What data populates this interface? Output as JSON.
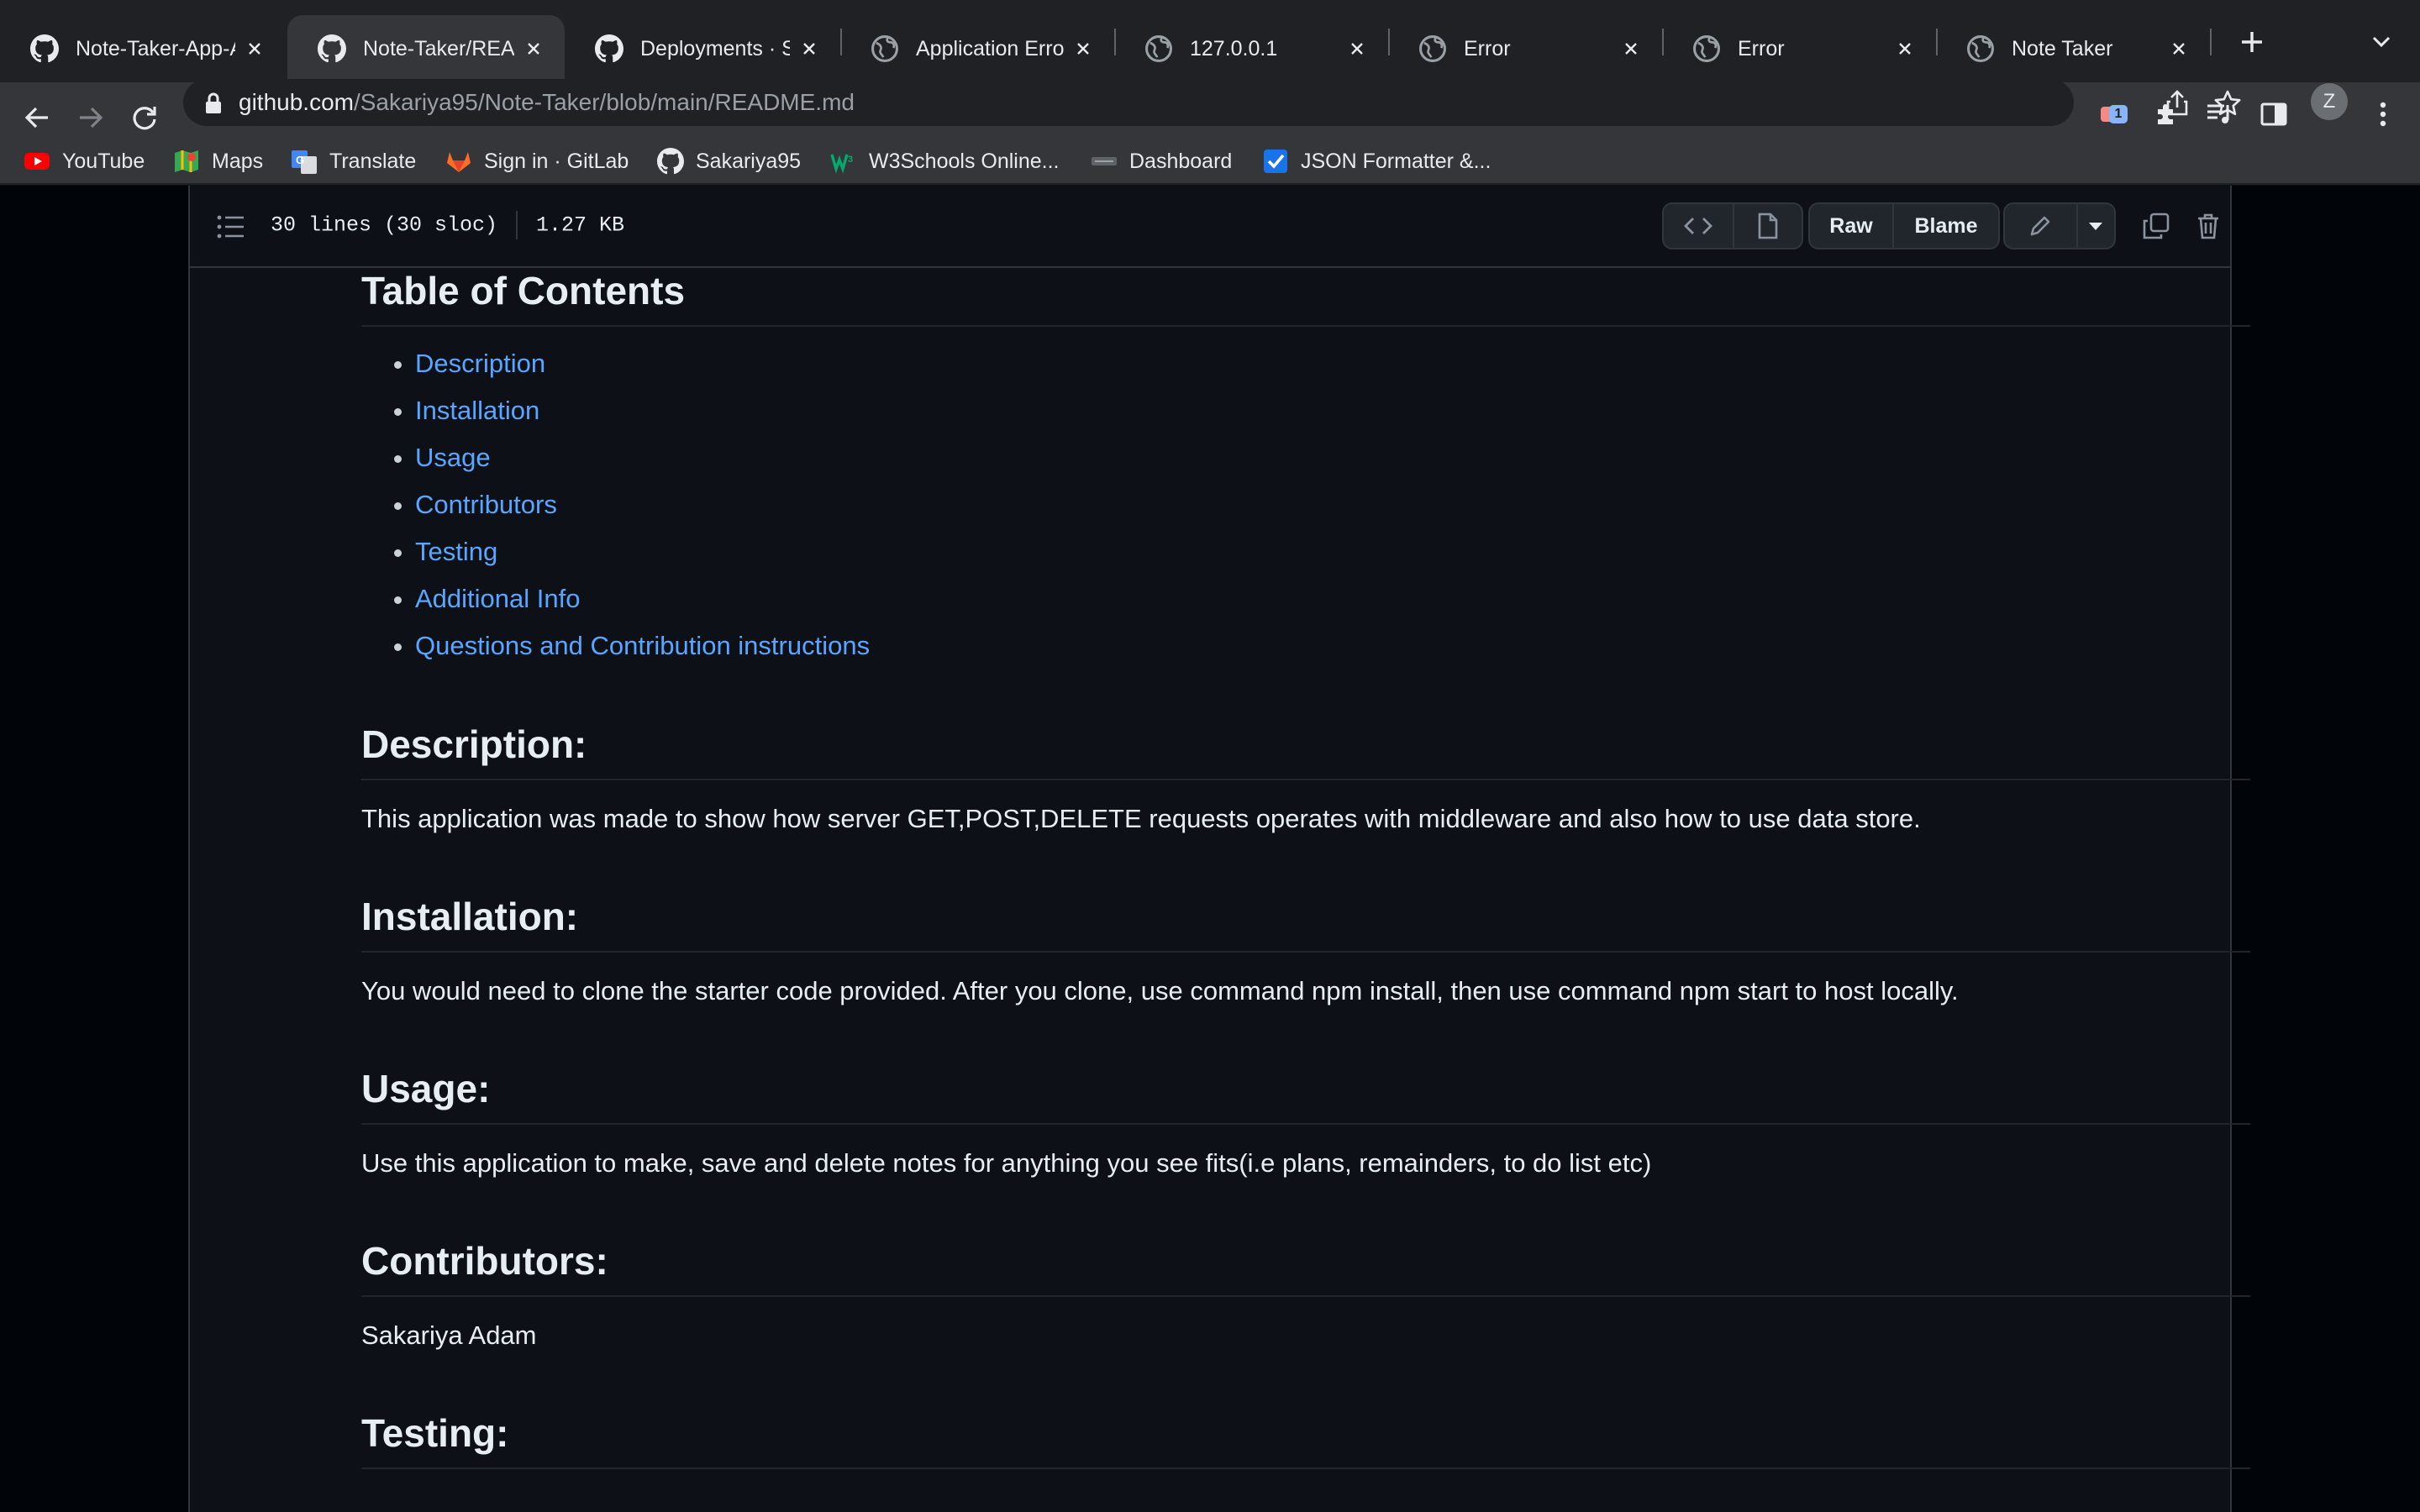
{
  "browser": {
    "tabs": [
      {
        "title": "Note-Taker-App-A",
        "icon": "github-icon"
      },
      {
        "title": "Note-Taker/READ",
        "icon": "github-icon"
      },
      {
        "title": "Deployments · Sa",
        "icon": "github-icon"
      },
      {
        "title": "Application Error",
        "icon": "globe-icon"
      },
      {
        "title": "127.0.0.1",
        "icon": "globe-icon"
      },
      {
        "title": "Error",
        "icon": "globe-icon"
      },
      {
        "title": "Error",
        "icon": "globe-icon"
      },
      {
        "title": "Note Taker",
        "icon": "globe-icon"
      }
    ],
    "url_host": "github.com",
    "url_path": "/Sakariya95/Note-Taker/blob/main/README.md",
    "extension_badge": "1",
    "profile_initial": "Z",
    "bookmarks": [
      {
        "label": "YouTube",
        "icon": "youtube-icon"
      },
      {
        "label": "Maps",
        "icon": "maps-icon"
      },
      {
        "label": "Translate",
        "icon": "translate-icon"
      },
      {
        "label": "Sign in · GitLab",
        "icon": "gitlab-icon"
      },
      {
        "label": "Sakariya95",
        "icon": "github-icon"
      },
      {
        "label": "W3Schools Online...",
        "icon": "w3schools-icon"
      },
      {
        "label": "Dashboard",
        "icon": "dashboard-icon"
      },
      {
        "label": "JSON Formatter &...",
        "icon": "checkbox-icon"
      }
    ]
  },
  "file": {
    "lines": "30 lines (30 sloc)",
    "size": "1.27 KB",
    "raw_label": "Raw",
    "blame_label": "Blame"
  },
  "readme": {
    "toc_heading": "Table of Contents",
    "toc": [
      "Description",
      "Installation",
      "Usage",
      "Contributors",
      "Testing",
      "Additional Info",
      "Questions and Contribution instructions"
    ],
    "sections": [
      {
        "heading": "Description:",
        "text": "This application was made to show how server GET,POST,DELETE requests operates with middleware and also how to use data store."
      },
      {
        "heading": "Installation:",
        "text": "You would need to clone the starter code provided. After you clone, use command npm install, then use command npm start to host locally."
      },
      {
        "heading": "Usage:",
        "text": "Use this application to make, save and delete notes for anything you see fits(i.e plans, remainders, to do list etc)"
      },
      {
        "heading": "Contributors:",
        "text": "Sakariya Adam"
      },
      {
        "heading": "Testing:",
        "text": ""
      }
    ]
  },
  "colors": {
    "link": "#58a6ff",
    "page_bg": "#0d1117",
    "chrome_bg": "#35363a"
  }
}
